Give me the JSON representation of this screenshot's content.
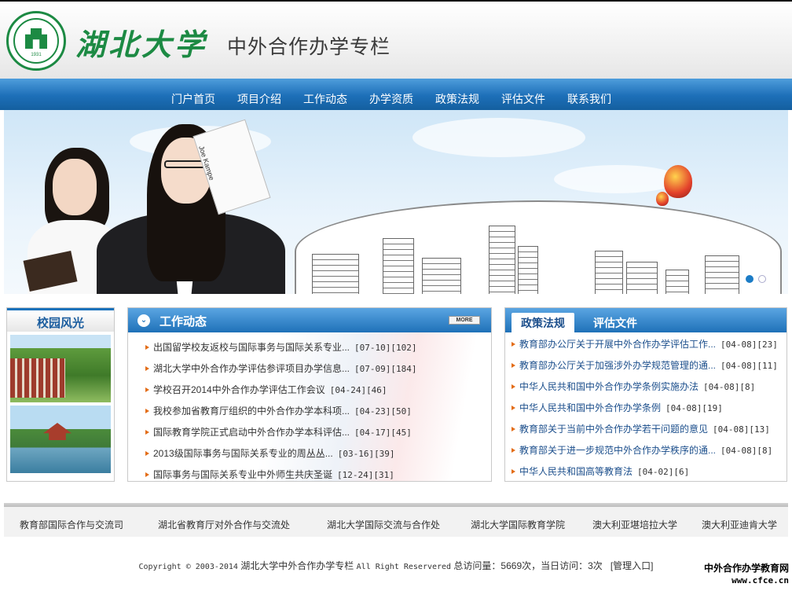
{
  "header": {
    "logo_year": "1931",
    "brand": "湖北大学",
    "subtitle": "中外合作办学专栏"
  },
  "nav": {
    "items": [
      "门户首页",
      "项目介绍",
      "工作动态",
      "办学资质",
      "政策法规",
      "评估文件",
      "联系我们"
    ]
  },
  "banner": {
    "newspaper_text": "Joe Kampe",
    "slide_count": 2,
    "active_slide": 1
  },
  "campus": {
    "title": "校园风光"
  },
  "news": {
    "title": "工作动态",
    "more_label": "MORE",
    "items": [
      {
        "text": "出国留学校友返校与国际事务与国际关系专业...",
        "date": "[07-10]",
        "count": "[102]"
      },
      {
        "text": "湖北大学中外合作办学评估参评项目办学信息...",
        "date": "[07-09]",
        "count": "[184]"
      },
      {
        "text": "学校召开2014中外合作办学评估工作会议",
        "date": "[04-24]",
        "count": "[46]"
      },
      {
        "text": "我校参加省教育厅组织的中外合作办学本科项...",
        "date": "[04-23]",
        "count": "[50]"
      },
      {
        "text": "国际教育学院正式启动中外合作办学本科评估...",
        "date": "[04-17]",
        "count": "[45]"
      },
      {
        "text": "2013级国际事务与国际关系专业的周丛丛...",
        "date": "[03-16]",
        "count": "[39]"
      },
      {
        "text": "国际事务与国际关系专业中外师生共庆圣诞",
        "date": "[12-24]",
        "count": "[31]"
      }
    ]
  },
  "policy": {
    "tab_active": "政策法规",
    "tab_inactive": "评估文件",
    "items": [
      {
        "text": "教育部办公厅关于开展中外合作办学评估工作...",
        "date": "[04-08]",
        "count": "[23]"
      },
      {
        "text": "教育部办公厅关于加强涉外办学规范管理的通...",
        "date": "[04-08]",
        "count": "[11]"
      },
      {
        "text": "中华人民共和国中外合作办学条例实施办法",
        "date": "[04-08]",
        "count": "[8]"
      },
      {
        "text": "中华人民共和国中外合作办学条例",
        "date": "[04-08]",
        "count": "[19]"
      },
      {
        "text": "教育部关于当前中外合作办学若干问题的意见",
        "date": "[04-08]",
        "count": "[13]"
      },
      {
        "text": "教育部关于进一步规范中外合作办学秩序的通...",
        "date": "[04-08]",
        "count": "[8]"
      },
      {
        "text": "中华人民共和国高等教育法",
        "date": "[04-02]",
        "count": "[6]"
      }
    ]
  },
  "footer": {
    "links": [
      "教育部国际合作与交流司",
      "湖北省教育厅对外合作与交流处",
      "湖北大学国际交流与合作处",
      "湖北大学国际教育学院",
      "澳大利亚堪培拉大学",
      "澳大利亚迪肯大学"
    ],
    "copyright_prefix": "Copyright © 2003-2014",
    "site_name": "湖北大学中外合作办学专栏",
    "rights": "All Right Reservered",
    "stats": "总访问量：5669次，当日访问：3次",
    "admin_link": "[管理入口]"
  },
  "watermark": {
    "line1": "中外合作办学教育网",
    "line2": "www.cfce.cn"
  },
  "colors": {
    "brand_green": "#1c8a43",
    "nav_blue": "#1d6fb8",
    "link_blue": "#1c4f8c",
    "bullet_orange": "#e36d18"
  }
}
